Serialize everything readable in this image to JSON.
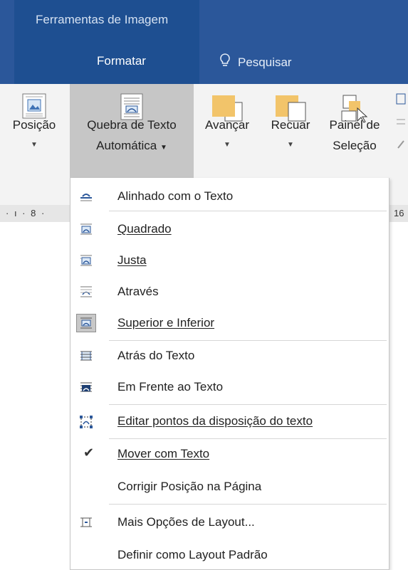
{
  "header": {
    "context_title": "Ferramentas de Imagem",
    "tab_formatar": "Formatar",
    "search_label": "Pesquisar"
  },
  "ribbon": {
    "posicao": "Posição",
    "quebra_l1": "Quebra de Texto",
    "quebra_l2": "Automática",
    "avancar": "Avançar",
    "recuar": "Recuar",
    "painel_l1": "Painel de",
    "painel_l2": "Seleção"
  },
  "ruler": {
    "left": "· ı · 8 ·",
    "right": "16"
  },
  "menu": {
    "items": [
      {
        "label": "Alinhado com o Texto"
      },
      {
        "label": "Quadrado"
      },
      {
        "label": "Justa"
      },
      {
        "label": "Através"
      },
      {
        "label": "Superior e Inferior"
      },
      {
        "label": "Atrás do Texto"
      },
      {
        "label": "Em Frente ao Texto"
      },
      {
        "label": "Editar pontos da disposição do texto"
      },
      {
        "label": "Mover com Texto"
      },
      {
        "label": "Corrigir Posição na Página"
      },
      {
        "label": "Mais Opções de Layout..."
      },
      {
        "label": "Definir como Layout Padrão"
      }
    ],
    "checked_item": "Mover com Texto",
    "selected_item": "Superior e Inferior"
  },
  "colors": {
    "title_bar": "#2b579a",
    "context_tab": "#1e4f91",
    "ribbon_bg": "#f3f3f3",
    "active_button": "#c6c6c6",
    "shape_orange": "#f2c46a"
  }
}
